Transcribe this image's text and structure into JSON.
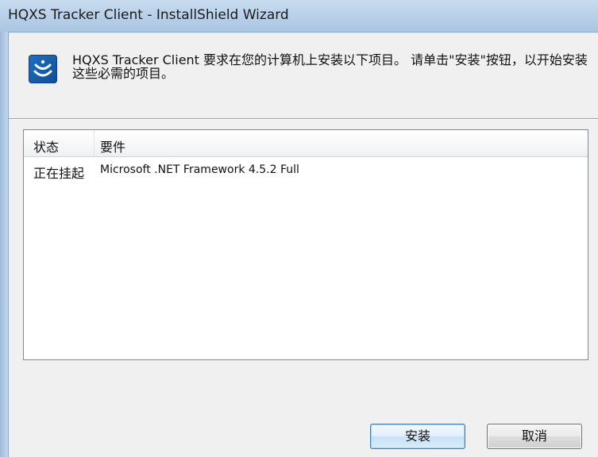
{
  "window": {
    "title": "HQXS Tracker Client - InstallShield Wizard"
  },
  "header": {
    "icon": "installshield-icon",
    "message": "HQXS Tracker Client 要求在您的计算机上安装以下项目。 请单击\"安装\"按钮，以开始安装这些必需的项目。"
  },
  "requirements": {
    "columns": {
      "status": "状态",
      "requirement": "要件"
    },
    "rows": [
      {
        "status": "正在挂起",
        "requirement": "Microsoft .NET Framework 4.5.2 Full"
      }
    ]
  },
  "buttons": {
    "install": "安装",
    "cancel": "取消"
  },
  "colors": {
    "titlebar": "#b7cfe8",
    "dialog_bg": "#f0f0f0",
    "icon_blue": "#1f6fc0",
    "default_button_border": "#3c7fb1"
  }
}
